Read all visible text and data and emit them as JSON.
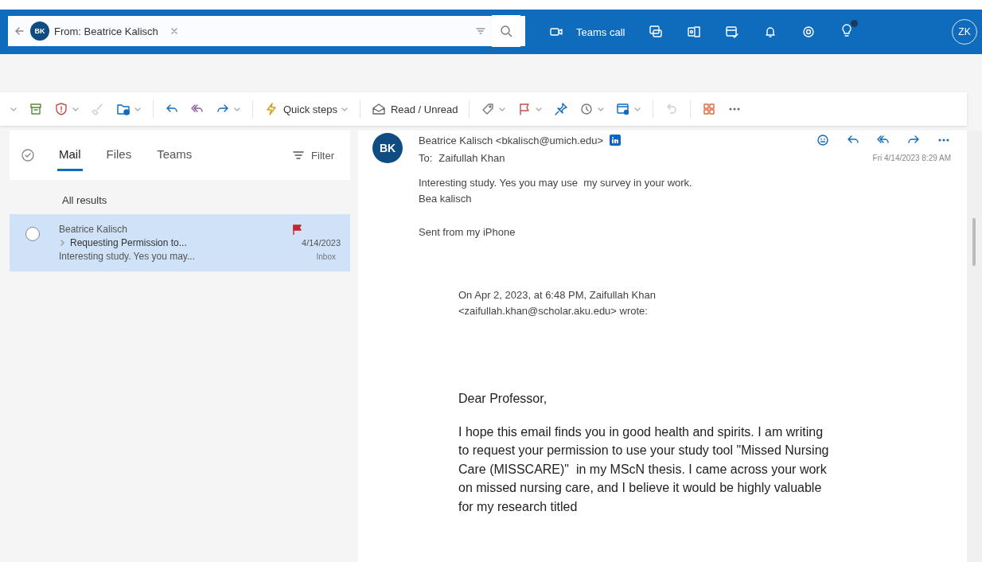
{
  "search": {
    "avatar": "BK",
    "chip": "From: Beatrice Kalisch"
  },
  "header": {
    "teams_call": "Teams call",
    "profile": "ZK"
  },
  "toolbar": {
    "quick_steps": "Quick steps",
    "read_unread": "Read / Unread"
  },
  "tabs": [
    {
      "label": "Mail",
      "selected": true
    },
    {
      "label": "Files",
      "selected": false
    },
    {
      "label": "Teams",
      "selected": false
    }
  ],
  "filter": "Filter",
  "results_heading": "All results",
  "messages": [
    {
      "sender": "Beatrice Kalisch",
      "subject": "Requesting Permission to...",
      "date": "4/14/2023",
      "preview": "Interesting study. Yes you may...",
      "folder": "Inbox",
      "flagged": true,
      "selected": true
    }
  ],
  "reading_pane": {
    "avatar": "BK",
    "from": "Beatrice Kalisch <bkalisch@umich.edu>",
    "to_label": "To:",
    "to": "Zaifullah Khan",
    "date": "Fri 4/14/2023 8:29 AM",
    "reply_lines": [
      "Interesting study. Yes you may use  my survey in your work.",
      "Bea kalisch"
    ],
    "signature": "Sent from my iPhone",
    "quote_header": "On Apr 2, 2023, at 6:48 PM, Zaifullah Khan <zaifullah.khan@scholar.aku.edu> wrote:",
    "greeting": "Dear Professor,",
    "paragraph": "I hope this email finds you in good health and spirits. I am writing to request your permission to use your study tool \"Missed Nursing Care (MISSCARE)\"  in my MScN thesis. I came across your work on missed nursing care, and I believe it would be highly valuable for my research titled"
  }
}
